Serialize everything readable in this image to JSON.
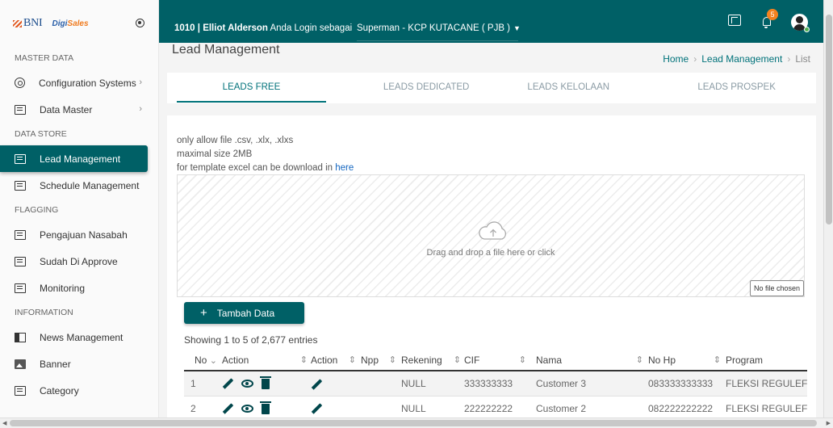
{
  "brand": {
    "bni": "BNI",
    "digi_a": "Digi",
    "digi_b": "Sales"
  },
  "sidebar": {
    "sections": [
      {
        "title": "MASTER DATA",
        "items": [
          {
            "label": "Configuration Systems",
            "icon": "gear-icon",
            "chevron": "›"
          },
          {
            "label": "Data Master",
            "icon": "list-icon",
            "chevron": "›"
          }
        ]
      },
      {
        "title": "DATA STORE",
        "items": [
          {
            "label": "Lead Management",
            "icon": "list-icon",
            "active": true
          },
          {
            "label": "Schedule Management",
            "icon": "list-icon"
          }
        ]
      },
      {
        "title": "FLAGGING",
        "items": [
          {
            "label": "Pengajuan Nasabah",
            "icon": "list-icon"
          },
          {
            "label": "Sudah Di Approve",
            "icon": "list-icon"
          },
          {
            "label": "Monitoring",
            "icon": "list-icon"
          }
        ]
      },
      {
        "title": "INFORMATION",
        "items": [
          {
            "label": "News Management",
            "icon": "news-icon"
          },
          {
            "label": "Banner",
            "icon": "image-icon"
          },
          {
            "label": "Category",
            "icon": "list-icon"
          }
        ]
      }
    ]
  },
  "header": {
    "user_info": "1010 | Elliot Alderson",
    "login_text": " Anda Login sebagai",
    "role": "Superman - KCP KUTACANE ( PJB )",
    "role_caret": "▼",
    "notification_count": "5"
  },
  "page": {
    "title": "Lead Management",
    "breadcrumb": [
      "Home",
      "Lead Management",
      "List"
    ],
    "breadcrumb_sep": "›"
  },
  "tabs": [
    "LEADS FREE",
    "LEADS DEDICATED",
    "LEADS KELOLAAN",
    "LEADS PROSPEK"
  ],
  "upload": {
    "note1": "only allow file .csv, .xlx, .xlxs",
    "note2": "maximal size 2MB",
    "note3": "for template excel can be download in ",
    "note3_link": "here",
    "drop_text": "Drag and drop a file here or click",
    "file_status": "No file chosen"
  },
  "add_button": {
    "icon": "+",
    "label": "Tambah Data"
  },
  "table": {
    "showing": "Showing 1 to 5 of 2,677 entries",
    "columns": [
      "No",
      "Action",
      "Action",
      "Npp",
      "Rekening",
      "CIF",
      "Nama",
      "No Hp",
      "Program"
    ],
    "rows": [
      {
        "no": "1",
        "npp": "",
        "rekening": "NULL",
        "cif": "333333333",
        "nama": "Customer 3",
        "nohp": "083333333333",
        "program": "FLEKSI REGULEF"
      },
      {
        "no": "2",
        "npp": "",
        "rekening": "NULL",
        "cif": "222222222",
        "nama": "Customer 2",
        "nohp": "082222222222",
        "program": "FLEKSI REGULEF"
      }
    ]
  },
  "colors": {
    "primary": "#006066",
    "badge": "#f5821f",
    "link": "#1466c0"
  }
}
